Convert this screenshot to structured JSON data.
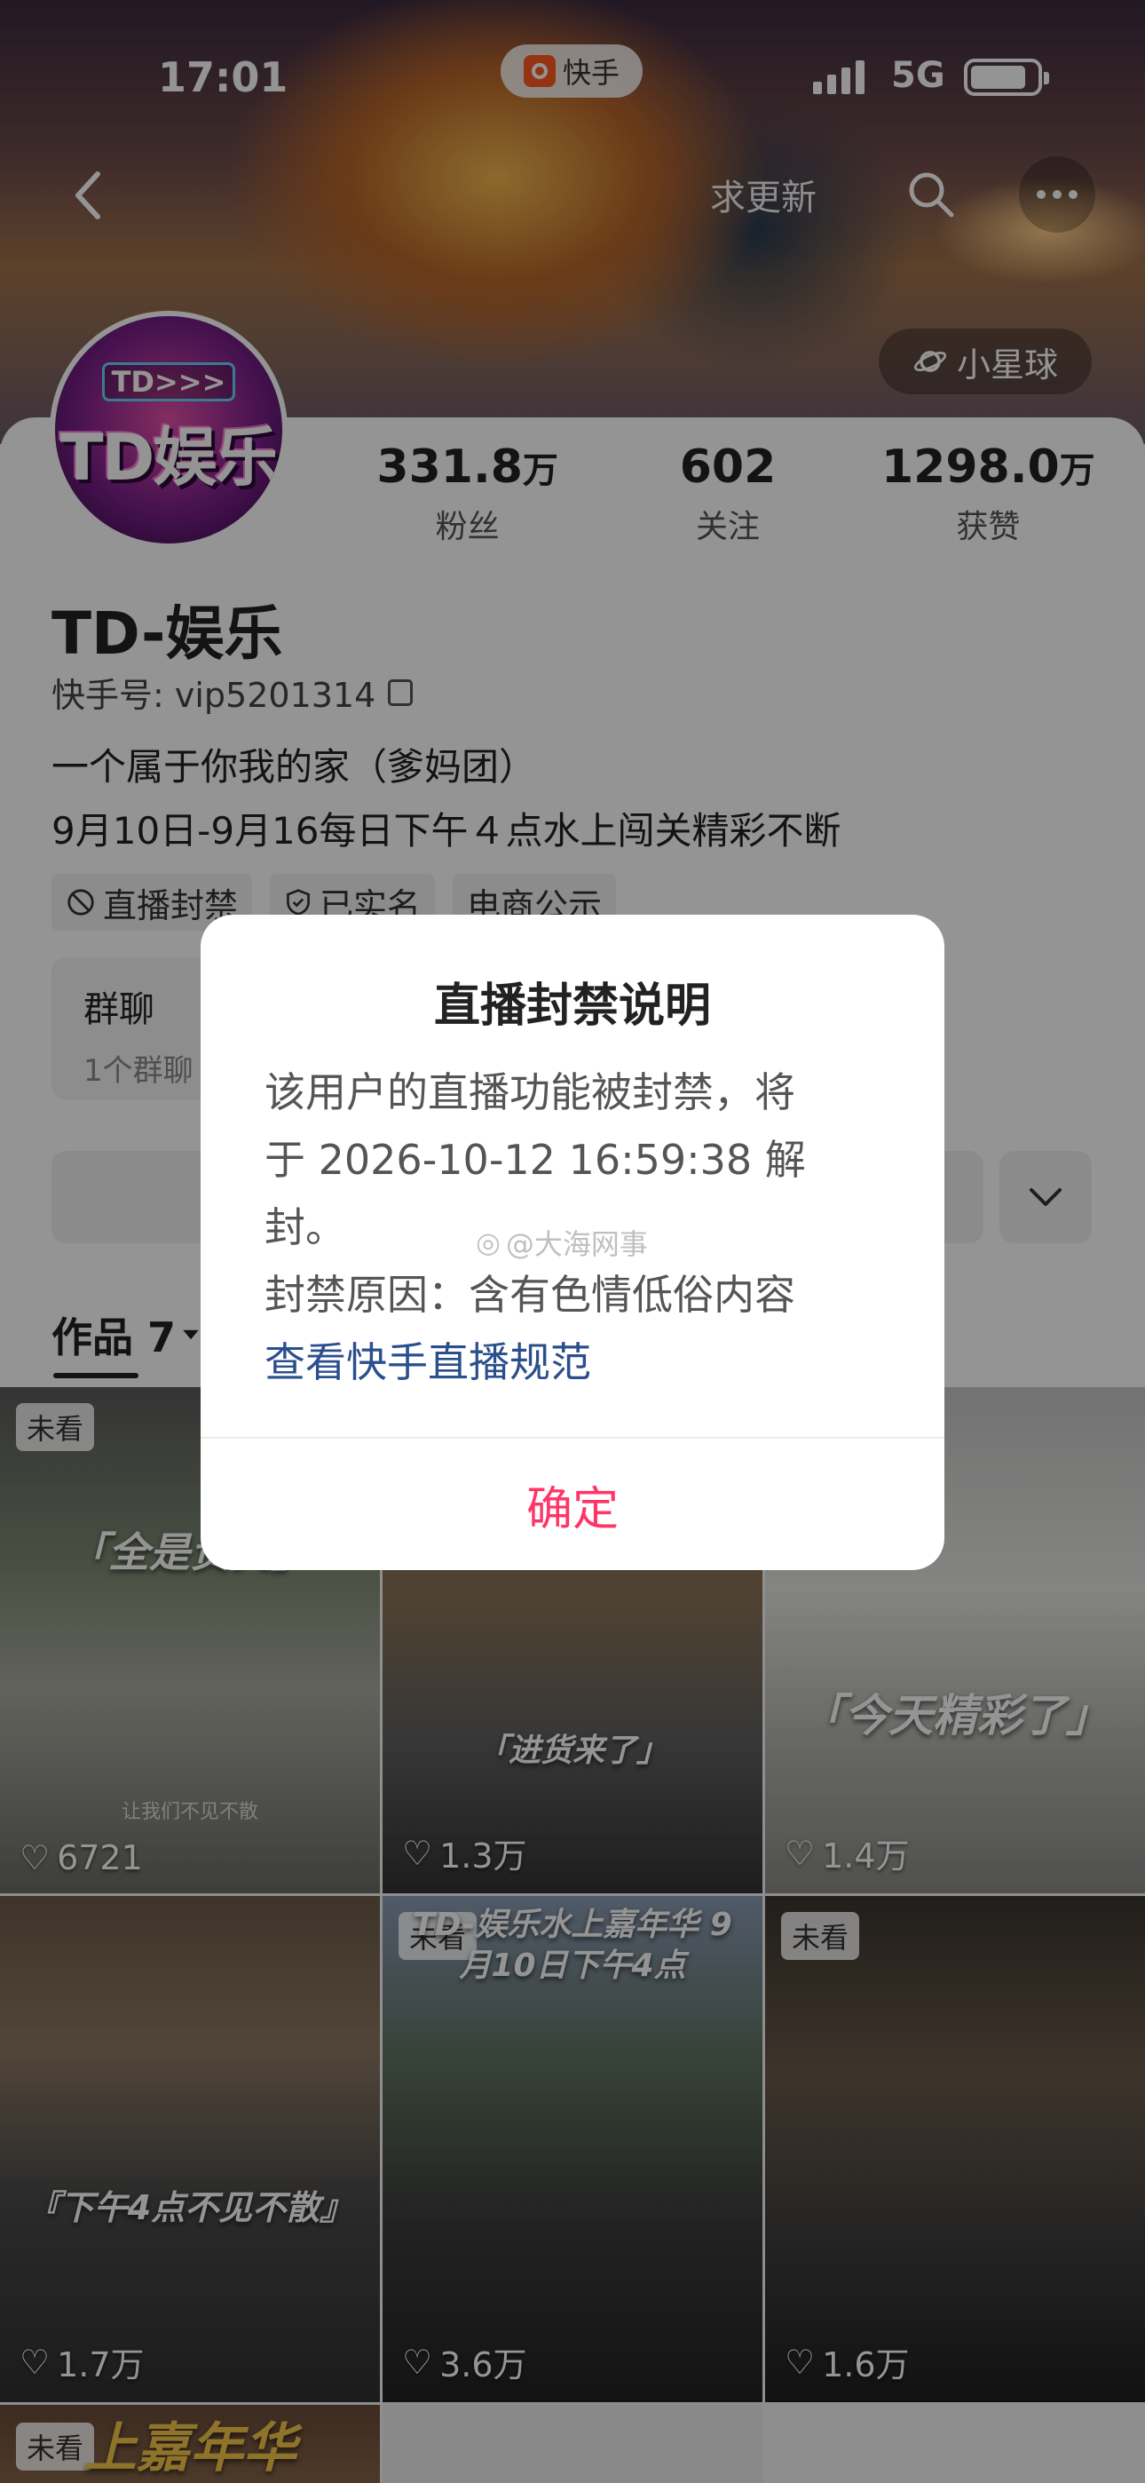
{
  "status_bar": {
    "time": "17:01",
    "app_pill": "快手",
    "network": "5G"
  },
  "header": {
    "update_button": "求更新",
    "planet_button": "小星球"
  },
  "avatar": {
    "mini_text": "TD>>>",
    "big_text": "TD娱乐"
  },
  "stats": [
    {
      "value": "331.8",
      "unit": "万",
      "label": "粉丝"
    },
    {
      "value": "602",
      "unit": "",
      "label": "关注"
    },
    {
      "value": "1298.0",
      "unit": "万",
      "label": "获赞"
    }
  ],
  "profile": {
    "name": "TD-娱乐",
    "id_label": "快手号: vip5201314",
    "bio_line1": "一个属于你我的家（爹妈团）",
    "bio_line2": "9月10日-9月16每日下午４点水上闯关精彩不断",
    "tags": [
      "直播封禁",
      "已实名",
      "电商公示"
    ],
    "group_title": "群聊",
    "group_sub": "1个群聊"
  },
  "works_tab": {
    "label": "作品 7"
  },
  "grid": [
    {
      "unseen": "未看",
      "caption": "「全是贵宾」",
      "sub": "让我们不见不散",
      "likes": "6721"
    },
    {
      "unseen": "",
      "caption": "「进货来了」",
      "sub": "",
      "likes": "1.3万"
    },
    {
      "unseen": "",
      "caption": "「今天精彩了」",
      "sub": "",
      "likes": "1.4万"
    },
    {
      "unseen": "",
      "caption": "『下午4点不见不散』",
      "sub": "",
      "likes": "1.7万"
    },
    {
      "unseen": "未看",
      "caption": "TD-娱乐水上嘉年华 9月10日下午4点",
      "sub": "",
      "likes": "3.6万"
    },
    {
      "unseen": "未看",
      "caption": "",
      "sub": "",
      "likes": "1.6万"
    },
    {
      "unseen": "未看",
      "caption": "上嘉年华",
      "sub": "",
      "likes": ""
    }
  ],
  "dialog": {
    "title": "直播封禁说明",
    "body_line1": "该用户的直播功能被封禁，将",
    "body_line2": "于 2026-10-12 16:59:38 解",
    "body_line3": "封。",
    "reason": "封禁原因：含有色情低俗内容",
    "link": "查看快手直播规范",
    "confirm": "确定"
  },
  "watermark": "@大海网事",
  "colors": {
    "confirm": "#fe3666",
    "link": "#2b4f8d",
    "app_brand": "#ff5a1f"
  }
}
